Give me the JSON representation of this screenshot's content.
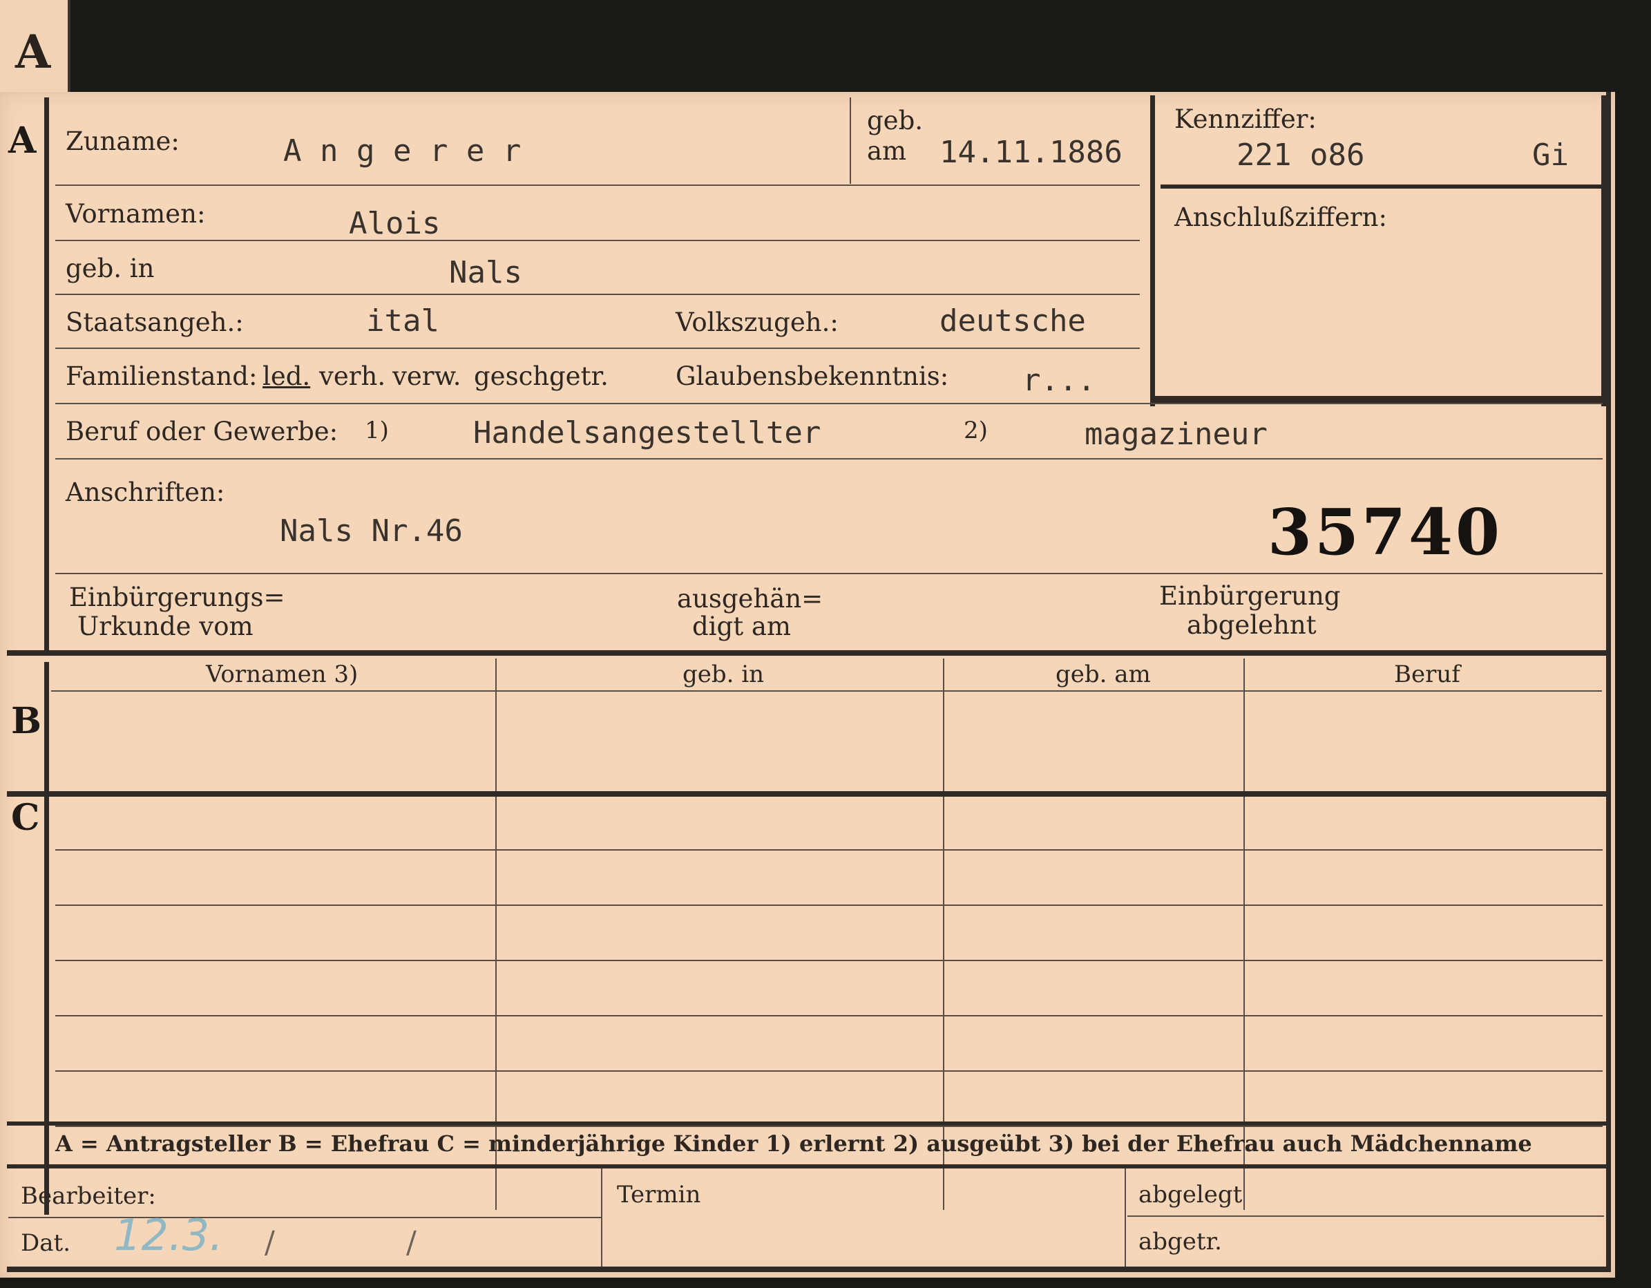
{
  "tab_letter": "A",
  "sections": {
    "a": "A",
    "b": "B",
    "c": "C"
  },
  "section_a": {
    "zuname_label": "Zuname:",
    "zuname_value": "A n g e r e r",
    "geb_label": "geb.",
    "am_label": "am",
    "geb_am_value": "14.11.1886",
    "vornamen_label": "Vornamen:",
    "vornamen_value": "Alois",
    "geb_in_label": "geb. in",
    "geb_in_value": "Nals",
    "staatsangeh_label": "Staatsangeh.:",
    "staatsangeh_value": "ital",
    "volkszugeh_label": "Volkszugeh.:",
    "volkszugeh_value": "deutsche",
    "familienstand_label": "Familienstand:",
    "familienstand_options": [
      "led.",
      "verh.",
      "verw.",
      "gesch.",
      "getr."
    ],
    "glaubens_label": "Glaubensbekenntnis:",
    "glaubens_value": "r...",
    "beruf_label": "Beruf oder Gewerbe:",
    "fn1": "1)",
    "fn2": "2)",
    "beruf_value_1": "Handelsangestellter",
    "beruf_value_2": "magazineur",
    "anschriften_label": "Anschriften:",
    "anschriften_value": "Nals Nr.46",
    "stamp_number": "35740",
    "einb_label_1": "Einbürgerungs=",
    "einb_label_2": "Urkunde vom",
    "ausgeh_label_1": "ausgehän=",
    "ausgeh_label_2": "digt am",
    "abgel_label_1": "Einbürgerung",
    "abgel_label_2": "abgelehnt"
  },
  "kennziffer": {
    "label": "Kennziffer:",
    "value": "221 o86",
    "initials": "Gi",
    "anschluss_label": "Anschlußziffern:"
  },
  "table_headers": [
    "Vornamen 3)",
    "geb. in",
    "geb. am",
    "Beruf"
  ],
  "legend": "A = Antragsteller   B = Ehefrau   C = minderjährige Kinder   1) erlernt   2) ausgeübt   3) bei der Ehefrau auch Mädchenname",
  "footer": {
    "bearbeiter_label": "Bearbeiter:",
    "dat_label": "Dat.",
    "dat_handwritten": "12.3.",
    "slash": "/",
    "termin_label": "Termin",
    "abgelegt_label": "abgelegt",
    "abgetr_label": "abgetr."
  }
}
